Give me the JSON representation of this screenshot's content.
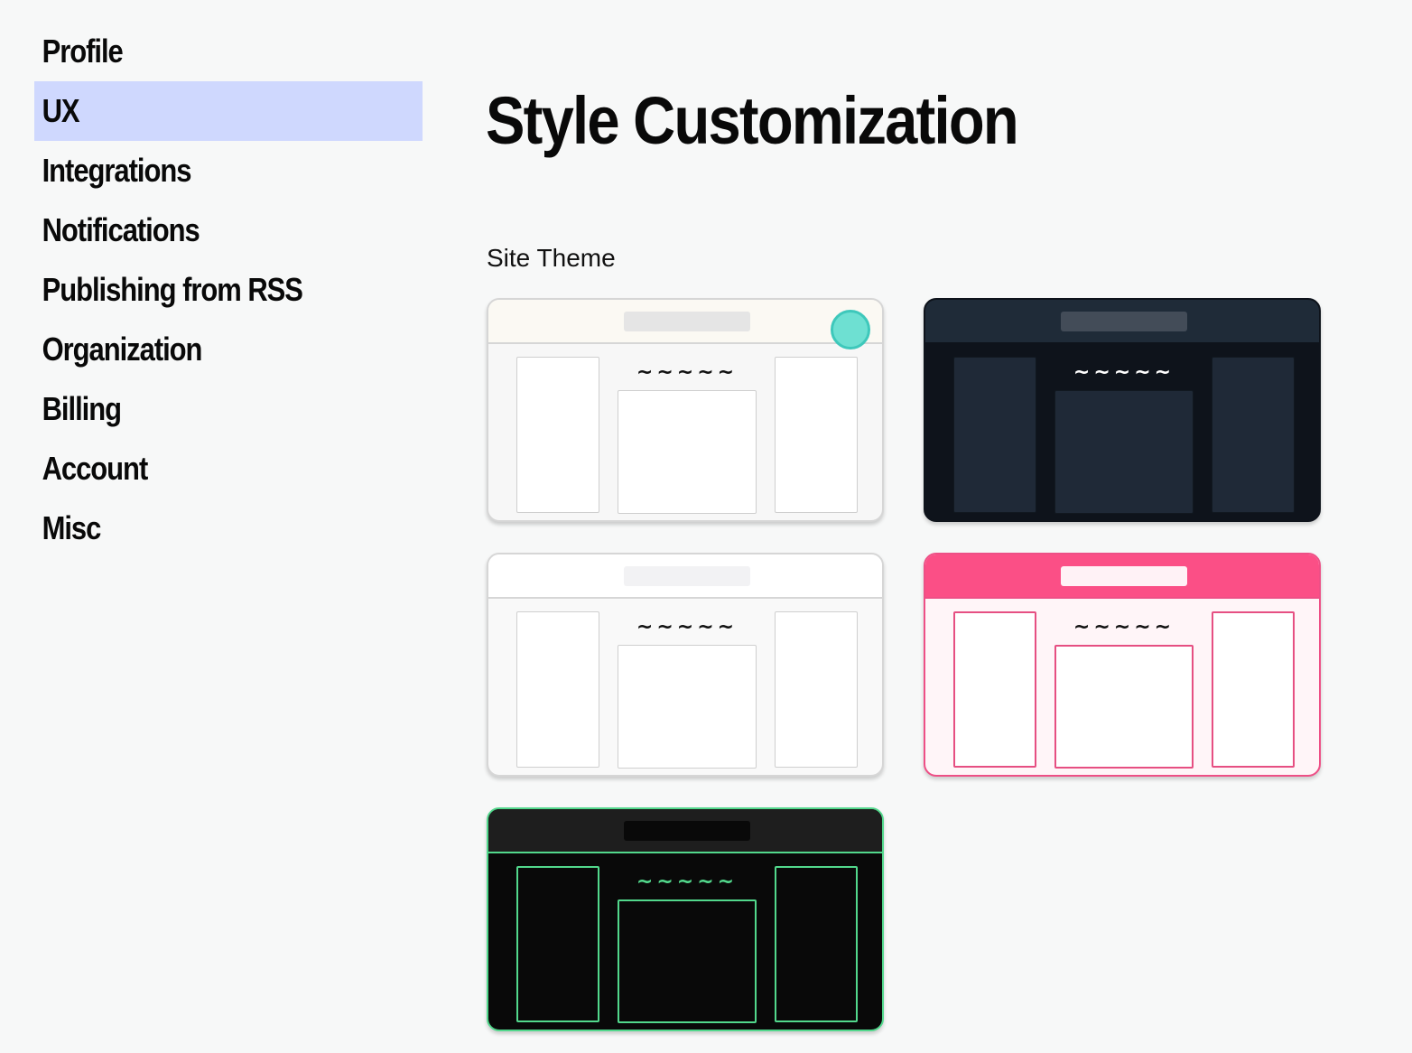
{
  "sidebar": {
    "items": [
      {
        "label": "Profile",
        "active": false
      },
      {
        "label": "UX",
        "active": true
      },
      {
        "label": "Integrations",
        "active": false
      },
      {
        "label": "Notifications",
        "active": false
      },
      {
        "label": "Publishing from RSS",
        "active": false
      },
      {
        "label": "Organization",
        "active": false
      },
      {
        "label": "Billing",
        "active": false
      },
      {
        "label": "Account",
        "active": false
      },
      {
        "label": "Misc",
        "active": false
      }
    ],
    "active_color": "#cfd8fe"
  },
  "main": {
    "title": "Style Customization",
    "section_label": "Site Theme",
    "squiggle": "~~~~~",
    "selected_theme": "light-cream",
    "themes": [
      {
        "id": "light-cream",
        "selected": true,
        "colors": {
          "body": "#f7f7f7",
          "header": "#fbf9f3",
          "header_bar": "#e5e5e5",
          "border": "#d6d6d6",
          "panel_bg": "#ffffff",
          "panel_border": "#cfcfcf",
          "squiggle": "#111111"
        }
      },
      {
        "id": "dark-navy",
        "selected": false,
        "colors": {
          "body": "#0e131b",
          "header": "#1f2b38",
          "header_bar": "#434c58",
          "border": "#0e131b",
          "panel_bg": "#1f2937",
          "panel_border": "#111820",
          "squiggle": "#ffffff"
        }
      },
      {
        "id": "minimal-white",
        "selected": false,
        "colors": {
          "body": "#f9f9f9",
          "header": "#ffffff",
          "header_bar": "#f2f2f4",
          "border": "#d6d6d6",
          "panel_bg": "#ffffff",
          "panel_border": "#cfcfcf",
          "squiggle": "#111111"
        }
      },
      {
        "id": "pink",
        "selected": false,
        "colors": {
          "body": "#fff5f8",
          "header": "#fb4f86",
          "header_bar": "#fff2f6",
          "border": "#ee4f86",
          "panel_bg": "#ffffff",
          "panel_border": "#e64f82",
          "squiggle": "#111111"
        }
      },
      {
        "id": "terminal-green",
        "selected": false,
        "colors": {
          "body": "#090909",
          "header": "#1e1e1e",
          "header_bar": "#090909",
          "border": "#52d88c",
          "panel_bg": "#090909",
          "panel_border": "#52d88c",
          "squiggle": "#52d88c"
        }
      }
    ],
    "selected_indicator_color": "#6ee0d2"
  }
}
